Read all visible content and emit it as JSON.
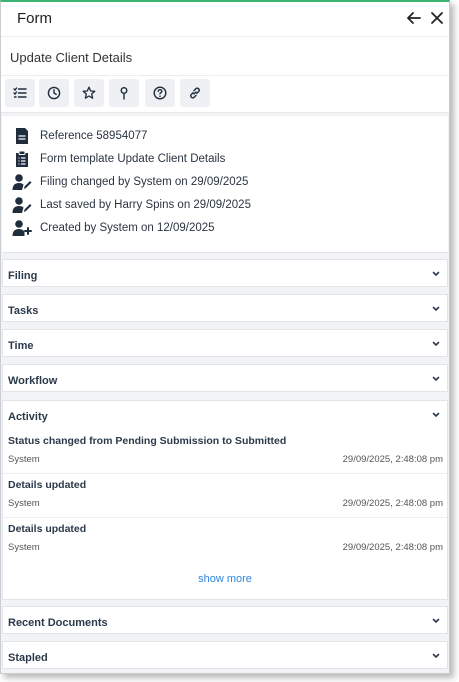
{
  "header": {
    "title": "Form"
  },
  "subtitle": "Update Client Details",
  "toolbar": {
    "buttons": [
      {
        "icon": "list-icon"
      },
      {
        "icon": "clock-icon"
      },
      {
        "icon": "star-icon"
      },
      {
        "icon": "pin-icon"
      },
      {
        "icon": "help-icon"
      },
      {
        "icon": "link-icon"
      }
    ]
  },
  "info": [
    {
      "icon": "document-icon",
      "text": "Reference 58954077"
    },
    {
      "icon": "clipboard-icon",
      "text": "Form template Update Client Details"
    },
    {
      "icon": "user-edit-icon",
      "text": "Filing changed by System on 29/09/2025"
    },
    {
      "icon": "user-edit-icon",
      "text": "Last saved by Harry Spins on 29/09/2025"
    },
    {
      "icon": "user-add-icon",
      "text": "Created by System on 12/09/2025"
    }
  ],
  "sections": {
    "filing": "Filing",
    "tasks": "Tasks",
    "time": "Time",
    "workflow": "Workflow",
    "activity": "Activity",
    "recent_documents": "Recent Documents",
    "stapled": "Stapled"
  },
  "activity": {
    "entries": [
      {
        "title": "Status changed from Pending Submission to Submitted",
        "actor": "System",
        "date": "29/09/2025, 2:48:08 pm"
      },
      {
        "title": "Details updated",
        "actor": "System",
        "date": "29/09/2025, 2:48:08 pm"
      },
      {
        "title": "Details updated",
        "actor": "System",
        "date": "29/09/2025, 2:48:08 pm"
      }
    ],
    "show_more": "show more"
  },
  "colors": {
    "accent": "#3cb371",
    "link": "#2e86de",
    "icon": "#1f2d3d"
  }
}
